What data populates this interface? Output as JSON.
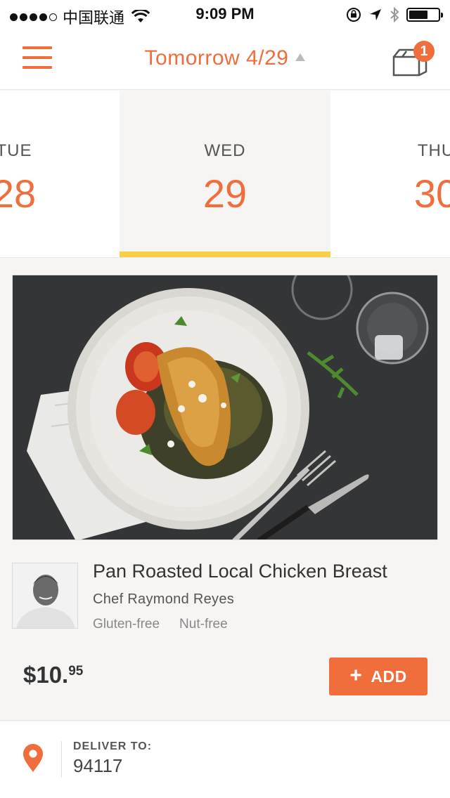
{
  "status_bar": {
    "carrier": "中国联通",
    "time": "9:09 PM"
  },
  "header": {
    "title": "Tomorrow 4/29",
    "cart_count": "1",
    "accent_color": "#f06d3c"
  },
  "date_tabs": [
    {
      "day": "TUE",
      "date": "28",
      "selected": false
    },
    {
      "day": "WED",
      "date": "29",
      "selected": true
    },
    {
      "day": "THU",
      "date": "30",
      "selected": false
    }
  ],
  "meal": {
    "name": "Pan Roasted Local Chicken Breast",
    "chef": "Chef Raymond Reyes",
    "tags": [
      "Gluten-free",
      "Nut-free"
    ],
    "price_main": "$10.",
    "price_cents": "95",
    "add_label": "ADD",
    "add_icon": "+"
  },
  "delivery": {
    "label": "DELIVER TO:",
    "zip": "94117"
  },
  "icons": {
    "menu": "hamburger-icon",
    "cart": "shopping-bag-icon",
    "location": "map-pin-icon"
  }
}
